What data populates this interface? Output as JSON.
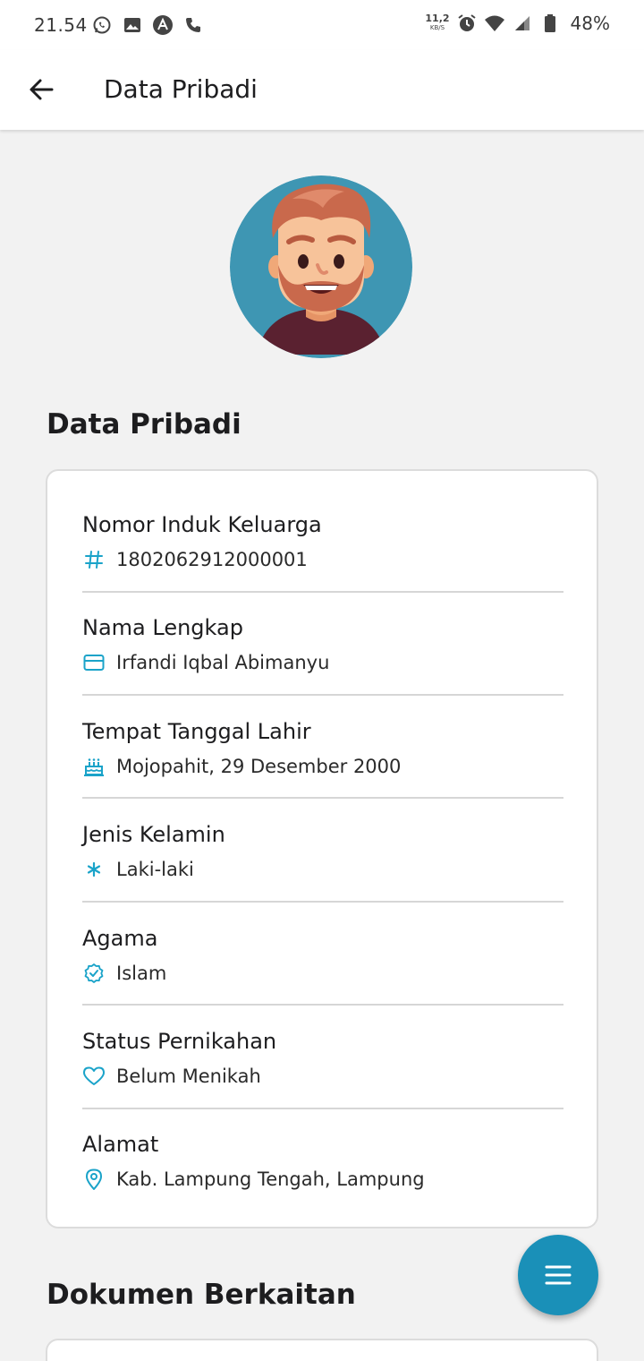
{
  "status_bar": {
    "time": "21.54",
    "speed_value": "11,2",
    "speed_unit": "KB/S",
    "battery": "48%",
    "left_icons": [
      "whatsapp-icon",
      "gallery-icon",
      "app-icon",
      "phone-icon"
    ],
    "right_icons": [
      "alarm-icon",
      "wifi-icon",
      "signal-icon",
      "battery-icon"
    ]
  },
  "appbar": {
    "title": "Data Pribadi"
  },
  "profile": {
    "section_title": "Data Pribadi",
    "fields": [
      {
        "label": "Nomor Induk Keluarga",
        "value": "1802062912000001",
        "icon": "hash-icon"
      },
      {
        "label": "Nama Lengkap",
        "value": "Irfandi Iqbal Abimanyu",
        "icon": "id-card-icon"
      },
      {
        "label": "Tempat Tanggal Lahir",
        "value": "Mojopahit, 29 Desember 2000",
        "icon": "cake-icon"
      },
      {
        "label": "Jenis Kelamin",
        "value": "Laki-laki",
        "icon": "asterisk-icon"
      },
      {
        "label": "Agama",
        "value": "Islam",
        "icon": "verified-badge-icon"
      },
      {
        "label": "Status Pernikahan",
        "value": "Belum Menikah",
        "icon": "heart-icon"
      },
      {
        "label": "Alamat",
        "value": "Kab. Lampung Tengah, Lampung",
        "icon": "location-pin-icon"
      }
    ]
  },
  "documents": {
    "section_title": "Dokumen Berkaitan"
  },
  "fab": {
    "icon": "menu-icon"
  },
  "colors": {
    "accent": "#1aa3c9",
    "fab": "#1a90b8",
    "background": "#f2f2f2",
    "avatar_bg": "#3e96b3"
  }
}
